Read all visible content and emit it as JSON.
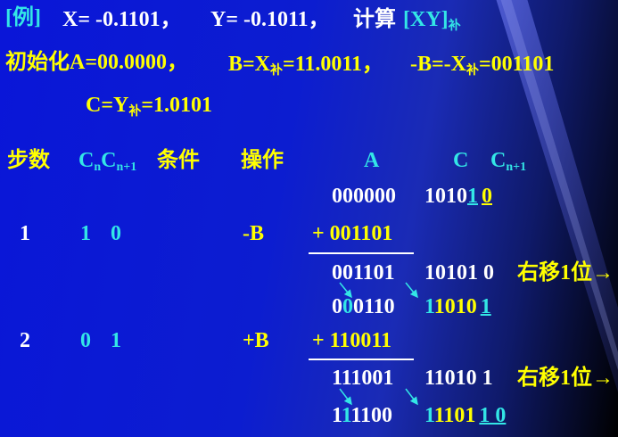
{
  "line1": {
    "example_tag": "[例]",
    "x_eq": "X= -0.1101，",
    "y_eq": "Y= -0.1011，",
    "compute": "计算",
    "xy": "[XY]",
    "xy_sub": "补"
  },
  "line2": {
    "init": "初始化A=00.0000，",
    "b_a": "B=X",
    "b_sub": "补",
    "b_b": "=11.0011，",
    "nb_a": "-B=-X",
    "nb_sub": "补",
    "nb_b": "=001101"
  },
  "line3": {
    "c_a": "C=Y",
    "c_sub": "补",
    "c_b": "=1.0101"
  },
  "header": {
    "steps": "步数",
    "cn": "C",
    "cn_sub": "n",
    "cn1": "C",
    "cn1_sub": "n+1",
    "condition": "条件",
    "operation": "操作",
    "col_a": "A",
    "col_c": "C",
    "col_cn1": "C",
    "col_cn1_sub": "n+1"
  },
  "rows": {
    "init_a": "000000",
    "init_c_a": "1010",
    "init_c_b": "1",
    "init_c_c": "0",
    "step1": {
      "num": "1",
      "cn": "1",
      "cn1": "0",
      "op": "-B",
      "addend": "+ 001101"
    },
    "sum1_a": "001101",
    "sum1_c": "10101 0",
    "shift_label_1": "右移1位→",
    "shift1_a1": "0",
    "shift1_a2": "0",
    "shift1_a3": "0110",
    "shift1_c1": "1",
    "shift1_c2": "1010",
    "shift1_c3": "1",
    "step2": {
      "num": "2",
      "cn": "0",
      "cn1": "1",
      "op": "+B",
      "addend": "+ 110011"
    },
    "sum2_a": "111001",
    "sum2_c": "11010 1",
    "shift_label_2": "右移1位→",
    "shift2_a1": "1",
    "shift2_a2": "1",
    "shift2_a3": "1100",
    "shift2_c1": "1",
    "shift2_c2": "1101",
    "shift2_c3": "1 0"
  },
  "colors": {
    "yellow": "#ffff00",
    "white": "#ffffff",
    "cyan": "#33e6e6",
    "background": "#0a16d8"
  }
}
